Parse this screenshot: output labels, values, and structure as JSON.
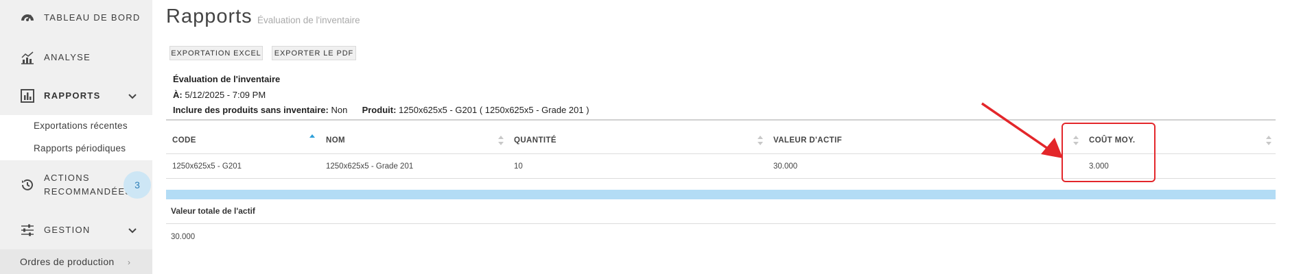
{
  "sidebar": {
    "items": [
      {
        "label": "TABLEAU DE BORD",
        "icon": "dashboard-gauge-icon"
      },
      {
        "label": "ANALYSE",
        "icon": "analytics-chart-icon"
      },
      {
        "label": "RAPPORTS",
        "icon": "reports-bar-chart-icon",
        "active": true
      },
      {
        "label_line1": "ACTIONS",
        "label_line2": "RECOMMANDÉES",
        "icon": "history-clock-icon",
        "badge": "3"
      },
      {
        "label": "GESTION",
        "icon": "sliders-icon"
      }
    ],
    "sub_items": [
      "Exportations récentes",
      "Rapports périodiques"
    ],
    "bottom_item": "Ordres de production"
  },
  "page": {
    "title": "Rapports",
    "subtitle": "Évaluation de l'inventaire"
  },
  "toolbar": {
    "excel_label": "EXPORTATION EXCEL",
    "pdf_label": "EXPORTER LE PDF"
  },
  "report": {
    "title": "Évaluation de l'inventaire",
    "date_label": "À:",
    "date_value": "5/12/2025 - 7:09 PM",
    "include_label": "Inclure des produits sans inventaire:",
    "include_value": "Non",
    "product_label": "Produit:",
    "product_value": "1250x625x5 - G201 ( 1250x625x5 - Grade 201 )"
  },
  "table": {
    "columns": [
      "CODE",
      "NOM",
      "QUANTITÉ",
      "VALEUR D'ACTIF",
      "COÛT MOY."
    ],
    "rows": [
      [
        "1250x625x5 - G201",
        "1250x625x5 - Grade 201",
        "10",
        "30.000",
        "3.000"
      ]
    ]
  },
  "totals": {
    "label": "Valeur totale de l'actif",
    "value": "30.000"
  },
  "colors": {
    "accent": "#2d9fd9",
    "highlight_band": "#b3dcf5",
    "annotation_red": "#e3262a",
    "sidebar_bg": "#f0f0f0"
  }
}
